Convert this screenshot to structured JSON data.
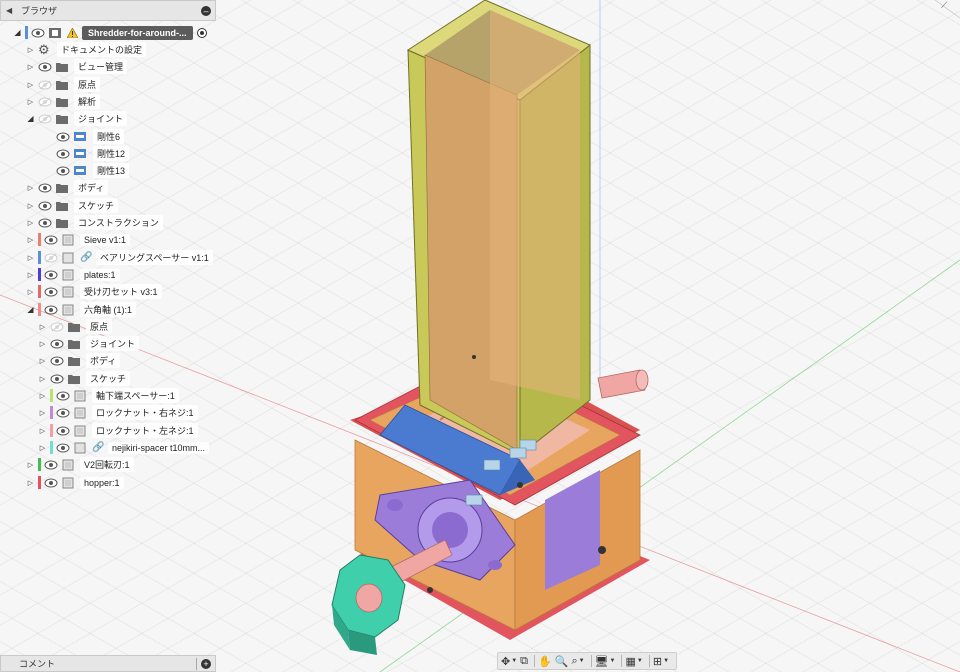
{
  "browser": {
    "title": "ブラウザ",
    "root": "Shredder-for-around-...",
    "items": [
      {
        "label": "ドキュメントの設定",
        "depth": 1,
        "type": "gear",
        "arrow": "closed"
      },
      {
        "label": "ビュー管理",
        "depth": 1,
        "type": "folder",
        "arrow": "closed"
      },
      {
        "label": "原点",
        "depth": 1,
        "type": "folder",
        "arrow": "closed",
        "eye": "hidden"
      },
      {
        "label": "解析",
        "depth": 1,
        "type": "folder",
        "arrow": "closed",
        "eye": "hidden"
      },
      {
        "label": "ジョイント",
        "depth": 1,
        "type": "folder",
        "arrow": "open",
        "eye": "hidden"
      },
      {
        "label": "剛性6",
        "depth": 2,
        "type": "joint"
      },
      {
        "label": "剛性12",
        "depth": 2,
        "type": "joint"
      },
      {
        "label": "剛性13",
        "depth": 2,
        "type": "joint"
      },
      {
        "label": "ボディ",
        "depth": 1,
        "type": "folder",
        "arrow": "closed"
      },
      {
        "label": "スケッチ",
        "depth": 1,
        "type": "folder",
        "arrow": "closed"
      },
      {
        "label": "コンストラクション",
        "depth": 1,
        "type": "folder",
        "arrow": "closed"
      },
      {
        "label": "Sieve v1:1",
        "depth": 1,
        "type": "component",
        "arrow": "closed",
        "color": "#e9806f"
      },
      {
        "label": "ベアリングスペーサー v1:1",
        "depth": 1,
        "type": "link",
        "arrow": "closed",
        "color": "#5b8fd6",
        "eye": "hidden"
      },
      {
        "label": "plates:1",
        "depth": 1,
        "type": "component",
        "arrow": "closed",
        "color": "#4a3fcf"
      },
      {
        "label": "受け刃セット v3:1",
        "depth": 1,
        "type": "component",
        "arrow": "closed",
        "color": "#e46a6a"
      },
      {
        "label": "六角軸 (1):1",
        "depth": 1,
        "type": "component",
        "arrow": "open",
        "color": "#f08a8a"
      },
      {
        "label": "原点",
        "depth": 2,
        "type": "folder",
        "arrow": "closed",
        "eye": "hidden"
      },
      {
        "label": "ジョイント",
        "depth": 2,
        "type": "folder",
        "arrow": "closed"
      },
      {
        "label": "ボディ",
        "depth": 2,
        "type": "folder",
        "arrow": "closed"
      },
      {
        "label": "スケッチ",
        "depth": 2,
        "type": "folder",
        "arrow": "closed"
      },
      {
        "label": "軸下端スペーサー:1",
        "depth": 2,
        "type": "component",
        "arrow": "closed",
        "color": "#b9e36b"
      },
      {
        "label": "ロックナット・右ネジ:1",
        "depth": 2,
        "type": "component",
        "arrow": "closed",
        "color": "#c48ad8"
      },
      {
        "label": "ロックナット・左ネジ:1",
        "depth": 2,
        "type": "component",
        "arrow": "closed",
        "color": "#f2a0a8"
      },
      {
        "label": "nejikiri-spacer t10mm...",
        "depth": 2,
        "type": "link",
        "arrow": "closed",
        "color": "#6fe0d8"
      },
      {
        "label": "V2回転刃:1",
        "depth": 1,
        "type": "component",
        "arrow": "closed",
        "color": "#3fbf4f"
      },
      {
        "label": "hopper:1",
        "depth": 1,
        "type": "component",
        "arrow": "closed",
        "color": "#e8505a"
      }
    ]
  },
  "comments": {
    "title": "コメント"
  },
  "toolbar": {
    "tools": [
      {
        "name": "orbit-icon",
        "glyph": "✥",
        "caret": true
      },
      {
        "name": "look-at-icon",
        "glyph": "⧉",
        "caret": false
      },
      {
        "name": "pan-icon",
        "glyph": "✋",
        "caret": false
      },
      {
        "name": "zoom-icon",
        "glyph": "🔍",
        "caret": false
      },
      {
        "name": "zoom-window-icon",
        "glyph": "⌕",
        "caret": true
      },
      {
        "name": "display-settings-icon",
        "glyph": "🖥",
        "caret": true
      },
      {
        "name": "grid-icon",
        "glyph": "▦",
        "caret": true
      },
      {
        "name": "viewports-icon",
        "glyph": "⊞",
        "caret": true
      }
    ]
  },
  "colors": {
    "hopper_yellow": "#c9c95a",
    "frame_orange": "#e8a560",
    "red": "#e2555f",
    "purple": "#9b7dd9",
    "blue": "#4b7bd1",
    "teal": "#3fcfaa",
    "pink_shaft": "#f0a7a3"
  }
}
